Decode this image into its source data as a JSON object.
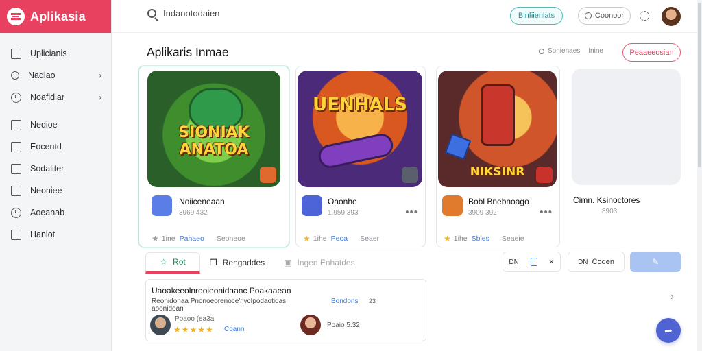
{
  "brand": {
    "title": "Aplikasia"
  },
  "sidebar": {
    "items": [
      {
        "label": "Uplicianis",
        "icon": "grid-icon",
        "chevron": false
      },
      {
        "label": "Nadiao",
        "icon": "search-icon",
        "chevron": true
      },
      {
        "label": "Noafidiar",
        "icon": "clock-icon",
        "chevron": true
      },
      {
        "label": "Nedioe",
        "icon": "store-icon",
        "chevron": false
      },
      {
        "label": "Eocentd",
        "icon": "calendar-icon",
        "chevron": false
      },
      {
        "label": "Sodaliter",
        "icon": "megaphone-icon",
        "chevron": false
      },
      {
        "label": "Neoniee",
        "icon": "document-icon",
        "chevron": false
      },
      {
        "label": "Aoeanab",
        "icon": "clock-icon",
        "chevron": false
      },
      {
        "label": "Hanlot",
        "icon": "chart-icon",
        "chevron": false
      }
    ]
  },
  "topbar": {
    "search_text": "Indanotodaien",
    "teal_pill": "Binfiienlats",
    "grey_pill": "Coonoor"
  },
  "main": {
    "section_title": "Aplikaris Inmae",
    "filter_1": "Sonienaes",
    "filter_2": "Inine",
    "action_pill": "Peaaeeosian"
  },
  "cards": [
    {
      "art_title": "SIONIAK ANATOA",
      "name": "Noiiceneaan",
      "size": "3969 432",
      "rating": "1ine",
      "link": "Pahaeo",
      "tag": "Seoneoe",
      "star_color": "#999999",
      "icon_color": "#5b7de8"
    },
    {
      "art_title": "UENHALS",
      "name": "Oaonhe",
      "size": "1.959 393",
      "rating": "1ihe",
      "link": "Peoa",
      "tag": "Seaer",
      "star_color": "#f2b21b",
      "icon_color": "#4c64d8"
    },
    {
      "art_title": "NIKSINR",
      "name": "Bobl Bnebnoago",
      "size": "3909 392",
      "rating": "1ihe",
      "link": "Sbles",
      "tag": "Seaeie",
      "star_color": "#f2b21b",
      "icon_color": "#e07b2e"
    },
    {
      "name": "Cimn. Ksinoctores",
      "size": "8903"
    }
  ],
  "tabs": [
    {
      "label": "Rot",
      "icon": "star-icon"
    },
    {
      "label": "Rengaddes",
      "icon": "cube-icon"
    },
    {
      "label": "Ingen Enhatdes",
      "icon": "image-icon"
    }
  ],
  "toolbar": {
    "tools_label": "DN",
    "button_label": "Coden",
    "button_prefix": "DN"
  },
  "review": {
    "title": "Uaoakeeolnrooieonidaanc Poakaaean",
    "line_1": "Reonidonaa  Pnonoeorenoce'r'ycIpodaotidas",
    "line_2": "aoonidoan",
    "link": "Bondons",
    "number": "23",
    "user_1": "Poaoo (ea3a",
    "stars": "★★★★★",
    "user_1_link": "Coann",
    "user_2": "Poaio 5.32"
  },
  "colors": {
    "brand": "#e8415f",
    "accent_teal": "#56b7b8",
    "accent_blue": "#4f63d2",
    "star": "#f2b21b"
  }
}
